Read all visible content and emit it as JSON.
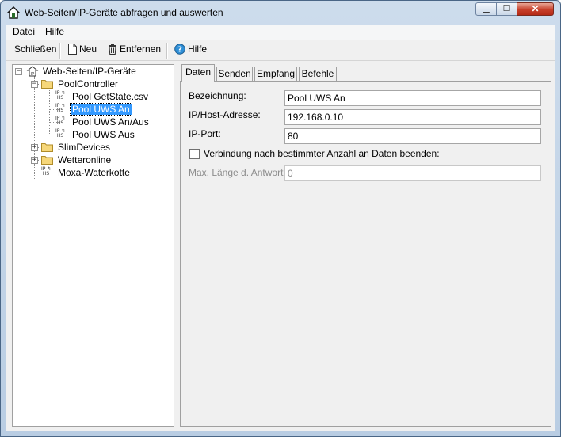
{
  "window": {
    "title": "Web-Seiten/IP-Geräte abfragen und auswerten",
    "controls": {
      "minimize": "▭",
      "maximize": "◻",
      "close": "✕"
    }
  },
  "menu": [
    {
      "label": "Datei"
    },
    {
      "label": "Hilfe"
    }
  ],
  "toolbar": {
    "close_label": "Schließen",
    "new_label": "Neu",
    "remove_label": "Entfernen",
    "help_label": "Hilfe"
  },
  "tree": {
    "root": "Web-Seiten/IP-Geräte",
    "folder_pool": "PoolController",
    "pool_items": [
      "Pool GetState.csv",
      "Pool UWS An",
      "Pool UWS An/Aus",
      "Pool UWS Aus"
    ],
    "folder_slim": "SlimDevices",
    "folder_wetter": "Wetteronline",
    "device_moxa": "Moxa-Waterkotte",
    "ip_icon_text": "IP HS",
    "selected": "Pool UWS An"
  },
  "tabs": [
    {
      "label": "Daten"
    },
    {
      "label": "Senden"
    },
    {
      "label": "Empfang"
    },
    {
      "label": "Befehle"
    }
  ],
  "form": {
    "bezeichnung_label": "Bezeichnung:",
    "bezeichnung_value": "Pool UWS An",
    "host_label": "IP/Host-Adresse:",
    "host_value": "192.168.0.10",
    "port_label": "IP-Port:",
    "port_value": "80",
    "checkbox_label": "Verbindung nach bestimmter Anzahl an Daten beenden:",
    "checkbox_checked": false,
    "maxlen_label": "Max. Länge d. Antwort:",
    "maxlen_value": "0"
  },
  "colors": {
    "selection": "#3399ff",
    "title_gradient_top": "#cddcec",
    "close_button": "#c7402b"
  }
}
